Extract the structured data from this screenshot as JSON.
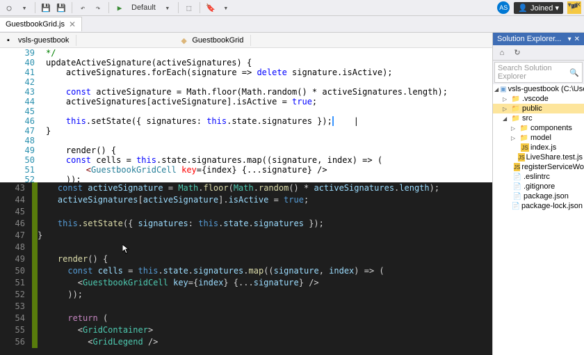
{
  "toolbar": {
    "config": "Default"
  },
  "titlebar": {
    "joined_label": "Joined"
  },
  "tab": {
    "filename": "GuestbookGrid.js"
  },
  "nav": {
    "namespace": "vsls-guestbook",
    "classname": "GuestbookGrid"
  },
  "solution": {
    "title": "Solution Explorer...",
    "search_placeholder": "Search Solution Explorer",
    "tree": {
      "root": "vsls-guestbook (C:\\User",
      "vscode": ".vscode",
      "public": "public",
      "src": "src",
      "components": "components",
      "model": "model",
      "index_js": "index.js",
      "liveshare_test": "LiveShare.test.js",
      "register_sw": "registerServiceWor",
      "eslintrc": ".eslintrc",
      "gitignore": ".gitignore",
      "package_json": "package.json",
      "package_lock": "package-lock.json"
    }
  },
  "light_code": {
    "l39": "*/",
    "l40_a": "updateActiveSignature(activeSignatures) {",
    "l41_a": "activeSignatures.forEach(signature => ",
    "l41_b": "delete",
    "l41_c": " signature.isActive);",
    "l43_a": "const",
    "l43_b": " activeSignature = Math.floor(Math.random() * activeSignatures.length);",
    "l44_a": "activeSignatures[activeSignature].isActive = ",
    "l44_b": "true",
    "l44_c": ";",
    "l46_a": "this",
    "l46_b": ".setState({ signatures: ",
    "l46_c": "this",
    "l46_d": ".state.signatures });",
    "l47": "}",
    "l49": "render() {",
    "l50_a": "const",
    "l50_b": " cells = ",
    "l50_c": "this",
    "l50_d": ".state.signatures.map((signature, index) => (",
    "l51_a": "<",
    "l51_b": "GuestbookGridCell",
    "l51_c": " ",
    "l51_d": "key",
    "l51_e": "={index} {...signature} />",
    "l52": "));"
  },
  "dark_code": {
    "l43_a": "const",
    "l43_b": " ",
    "l43_c": "activeSignature",
    "l43_d": " = ",
    "l43_e": "Math",
    "l43_f": ".",
    "l43_g": "floor",
    "l43_h": "(",
    "l43_i": "Math",
    "l43_j": ".",
    "l43_k": "random",
    "l43_l": "() * ",
    "l43_m": "activeSignatures",
    "l43_n": ".",
    "l43_o": "length",
    "l43_p": ");",
    "l44_a": "activeSignatures",
    "l44_b": "[",
    "l44_c": "activeSignature",
    "l44_d": "].",
    "l44_e": "isActive",
    "l44_f": " = ",
    "l44_g": "true",
    "l44_h": ";",
    "l46_a": "this",
    "l46_b": ".",
    "l46_c": "setState",
    "l46_d": "({ ",
    "l46_e": "signatures",
    "l46_f": ": ",
    "l46_g": "this",
    "l46_h": ".",
    "l46_i": "state",
    "l46_j": ".",
    "l46_k": "signatures",
    "l46_l": " });",
    "l47": "}",
    "l49_a": "render",
    "l49_b": "() {",
    "l50_a": "const",
    "l50_b": " ",
    "l50_c": "cells",
    "l50_d": " = ",
    "l50_e": "this",
    "l50_f": ".",
    "l50_g": "state",
    "l50_h": ".",
    "l50_i": "signatures",
    "l50_j": ".",
    "l50_k": "map",
    "l50_l": "((",
    "l50_m": "signature",
    "l50_n": ", ",
    "l50_o": "index",
    "l50_p": ") => (",
    "l51_a": "<",
    "l51_b": "GuestbookGridCell",
    "l51_c": " ",
    "l51_d": "key",
    "l51_e": "={",
    "l51_f": "index",
    "l51_g": "} {...",
    "l51_h": "signature",
    "l51_i": "} />",
    "l52": "));",
    "l54_a": "return",
    "l54_b": " (",
    "l55_a": "<",
    "l55_b": "GridContainer",
    "l55_c": ">",
    "l56_a": "<",
    "l56_b": "GridLegend",
    "l56_c": " />"
  },
  "line_numbers_light": [
    "39",
    "40",
    "41",
    "42",
    "43",
    "44",
    "45",
    "46",
    "47",
    "48",
    "49",
    "50",
    "51",
    "52"
  ],
  "line_numbers_dark": [
    "43",
    "44",
    "45",
    "46",
    "47",
    "48",
    "49",
    "50",
    "51",
    "52",
    "53",
    "54",
    "55",
    "56"
  ]
}
